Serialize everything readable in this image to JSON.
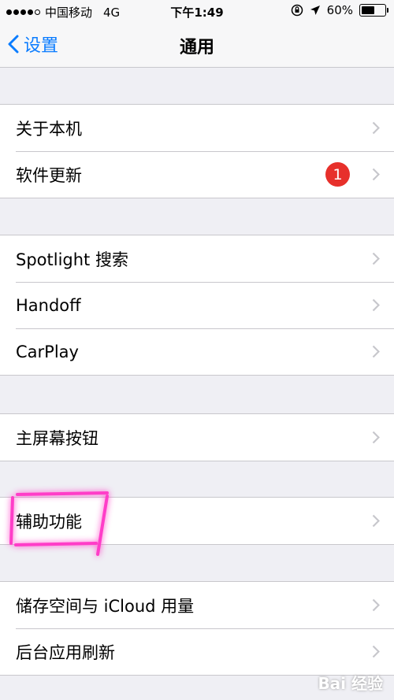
{
  "status_bar": {
    "carrier": "中国移动",
    "network": "4G",
    "time": "下午1:49",
    "battery_percent": "60%",
    "battery_level": 0.6
  },
  "nav": {
    "back_label": "设置",
    "title": "通用"
  },
  "groups": [
    {
      "items": [
        {
          "label": "关于本机"
        },
        {
          "label": "软件更新",
          "badge": "1"
        }
      ]
    },
    {
      "items": [
        {
          "label": "Spotlight 搜索"
        },
        {
          "label": "Handoff"
        },
        {
          "label": "CarPlay"
        }
      ]
    },
    {
      "items": [
        {
          "label": "主屏幕按钮"
        }
      ]
    },
    {
      "items": [
        {
          "label": "辅助功能"
        }
      ]
    },
    {
      "items": [
        {
          "label": "储存空间与 iCloud 用量"
        },
        {
          "label": "后台应用刷新"
        }
      ]
    }
  ],
  "watermark": "Bai 经验",
  "colors": {
    "accent": "#0a7cff",
    "badge": "#e7302b",
    "highlight": "#ff3ec8",
    "background": "#efeff4"
  }
}
